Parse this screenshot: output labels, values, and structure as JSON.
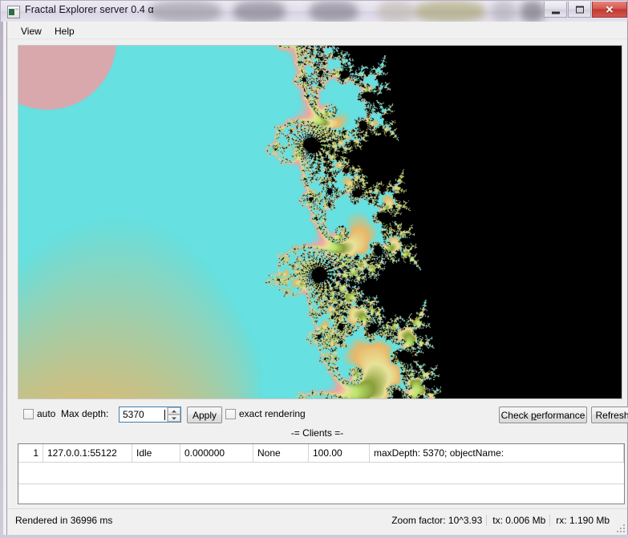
{
  "window": {
    "title": "Fractal Explorer server  0.4 α",
    "app_icon": "app-icon",
    "buttons": {
      "minimize": "minimize-button",
      "maximize": "maximize-button",
      "close_glyph": "✕"
    }
  },
  "menu": {
    "items": [
      {
        "label": "View",
        "name": "menu-view"
      },
      {
        "label": "Help",
        "name": "menu-help"
      }
    ]
  },
  "canvas": {
    "name": "fractal-render-canvas",
    "description": "Mandelbrot set fractal render",
    "palette": {
      "background_green": "#b8e36c",
      "olive": "#8aa03c",
      "cyan": "#66e0e0",
      "pink": "#f2a6a0",
      "mauve": "#d9a8ad",
      "cream": "#e8e39a",
      "orange": "#e8b86a",
      "interior_black": "#000000"
    }
  },
  "controls": {
    "auto_label": "auto",
    "auto_checked": false,
    "max_depth_label": "Max depth:",
    "max_depth_value": "5370",
    "max_depth_placeholder": "",
    "apply_label": "Apply",
    "exact_rendering_label": "exact rendering",
    "exact_rendering_checked": false,
    "check_performance_label_pre": "Check ",
    "check_performance_mnemonic": "p",
    "check_performance_label_post": "erformance",
    "refresh_label": "Refresh"
  },
  "clients": {
    "section_title": "-= Clients =-",
    "rows": [
      {
        "index": "1",
        "address": "127.0.0.1:55122",
        "state": "Idle",
        "progress": "0.000000",
        "task": "None",
        "percent": "100.00",
        "info": "maxDepth: 5370; objectName:"
      }
    ],
    "empty_row_placeholder": ""
  },
  "status": {
    "left": "Rendered in 36996 ms",
    "zoom_factor": "Zoom factor: 10^3.93",
    "tx": "tx: 0.006 Mb",
    "rx": "rx: 1.190 Mb"
  }
}
